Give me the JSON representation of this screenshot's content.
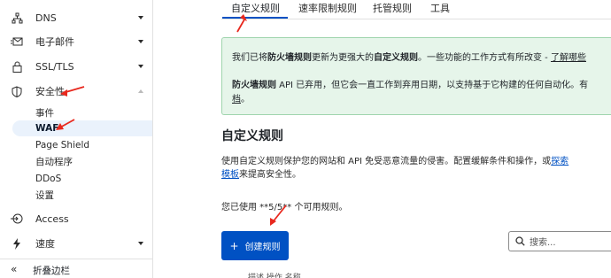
{
  "sidebar": {
    "items": [
      {
        "label": "DNS",
        "icon": "network-icon"
      },
      {
        "label": "电子邮件",
        "icon": "email-icon"
      },
      {
        "label": "SSL/TLS",
        "icon": "lock-icon"
      },
      {
        "label": "安全性",
        "icon": "shield-icon"
      },
      {
        "label": "Access",
        "icon": "access-icon"
      },
      {
        "label": "速度",
        "icon": "lightning-icon"
      }
    ],
    "security_sub": [
      "事件",
      "WAF",
      "Page Shield",
      "自动程序",
      "DDoS",
      "设置"
    ],
    "collapse_label": "折叠边栏"
  },
  "tabs": [
    "自定义规则",
    "速率限制规则",
    "托管规则",
    "工具"
  ],
  "banner": {
    "line1_a": "我们已将",
    "line1_b": "防火墙规则",
    "line1_c": "更新为更强大的",
    "line1_d": "自定义规则",
    "line1_e": "。一些功能的工作方式有所改变 - ",
    "line1_link": "了解哪些",
    "line2_a": "防火墙规则",
    "line2_b": " API 已弃用，但它会一直工作到弃用日期，以支持基于它构建的任何自动化。有",
    "line3_link": "档",
    "line3_end": "。"
  },
  "main": {
    "title": "自定义规则",
    "desc_a": "使用自定义规则保护您的网站和 API 免受恶意流量的侵害。配置缓解条件和操作，或",
    "desc_link1": "探索",
    "desc_link2": "模板",
    "desc_end": "来提高安全性。",
    "usage": "您已使用 **5/5** 个可用规则。",
    "create_button": "创建规则",
    "search_placeholder": "搜索...",
    "table_headers_partial": "描述    操作              名称"
  },
  "colors": {
    "accent": "#0051c3",
    "banner_bg": "#e6f5ea",
    "annotation_red": "#e8281e"
  }
}
